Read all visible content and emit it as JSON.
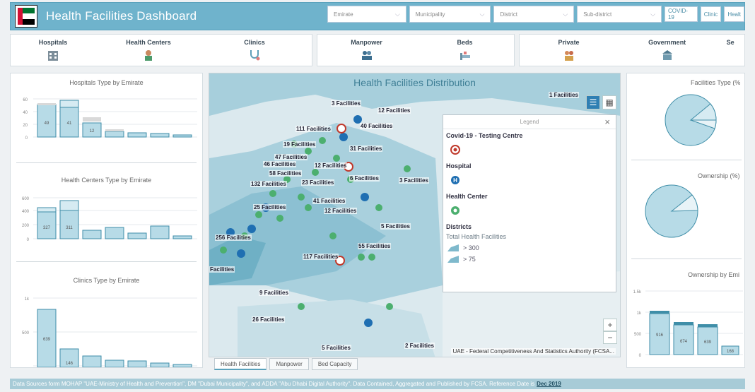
{
  "header": {
    "title": "Health Facilities Dashboard",
    "filters": [
      {
        "label": "Emirate"
      },
      {
        "label": "Municipality"
      },
      {
        "label": "District"
      },
      {
        "label": "Sub-district"
      }
    ],
    "buttons": [
      {
        "label": "COVID-19"
      },
      {
        "label": "Clinic"
      },
      {
        "label": "Healt"
      }
    ]
  },
  "categories": {
    "group1": [
      "Hospitals",
      "Health Centers",
      "Clinics"
    ],
    "group2": [
      "Manpower",
      "Beds"
    ],
    "group3": [
      "Private",
      "Government",
      "Se"
    ]
  },
  "left": {
    "hospitals": {
      "title": "Hospitals Type by Emirate",
      "yticks": [
        "60",
        "40",
        "20",
        "0"
      ],
      "labels": [
        "49",
        "41",
        "12"
      ]
    },
    "centers": {
      "title": "Health Centers Type by Emirate",
      "yticks": [
        "600",
        "400",
        "200",
        "0"
      ],
      "labels": [
        "327",
        "311"
      ]
    },
    "clinics": {
      "title": "Clinics Type by Emirate",
      "yticks": [
        "1k",
        "500",
        ""
      ],
      "labels": [
        "639",
        "146"
      ]
    }
  },
  "map": {
    "title": "Health Facilities Distribution",
    "labels": [
      {
        "t": "1 Facilities"
      },
      {
        "t": "3 Facilities"
      },
      {
        "t": "12 Facilities"
      },
      {
        "t": "111 Facilities"
      },
      {
        "t": "40 Facilities"
      },
      {
        "t": "19 Facilities"
      },
      {
        "t": "31 Facilities"
      },
      {
        "t": "47 Facilities"
      },
      {
        "t": "46 Facilities"
      },
      {
        "t": "12 Facilities"
      },
      {
        "t": "58 Facilities"
      },
      {
        "t": "6 Facilities"
      },
      {
        "t": "132 Facilities"
      },
      {
        "t": "23 Facilities"
      },
      {
        "t": "3 Facilities"
      },
      {
        "t": "41 Facilities"
      },
      {
        "t": "25 Facilities"
      },
      {
        "t": "12 Facilities"
      },
      {
        "t": "5 Facilities"
      },
      {
        "t": "256 Facilities"
      },
      {
        "t": "55 Facilities"
      },
      {
        "t": "117 Facilities"
      },
      {
        "t": "Facilities"
      },
      {
        "t": "9 Facilities"
      },
      {
        "t": "26 Facilities"
      },
      {
        "t": "5 Facilities"
      },
      {
        "t": "2 Facilities"
      }
    ],
    "attribution": "UAE - Federal Competitiveness And Statistics Authority (FCSA...",
    "legend": {
      "title": "Legend",
      "covid": "Covid-19 - Testing Centre",
      "hospital": "Hospital",
      "center": "Health Center",
      "districts": "Districts",
      "total": "Total Health Facilities",
      "ranges": [
        "> 300",
        "> 75"
      ]
    }
  },
  "right": {
    "type_title": "Facilities Type (%",
    "ownership_title": "Ownership (%)",
    "ownership_emirate_title": "Ownership by Emi",
    "yticks": [
      "1.5k",
      "1k",
      "500",
      "0"
    ],
    "labels": [
      "916",
      "674",
      "639",
      "168"
    ]
  },
  "tabs": [
    {
      "label": "Health Facilities"
    },
    {
      "label": "Manpower"
    },
    {
      "label": "Bed Capacity"
    }
  ],
  "footer": {
    "text": "Data Sources form MOHAP \"UAE-Ministry of Health and Prevention\", DM \"Dubai Municipality\", and ADDA \"Abu Dhabi Digital Authority\". Data Contained, Aggregated and Published by FCSA. Reference Date is",
    "date": "Dec 2019"
  },
  "colors": {
    "accent": "#6fb3cc",
    "bar": "#b7dbe7",
    "bar_edge": "#3f8ea8",
    "land": "#dbe9ee",
    "sea": "#a7cfdc"
  }
}
